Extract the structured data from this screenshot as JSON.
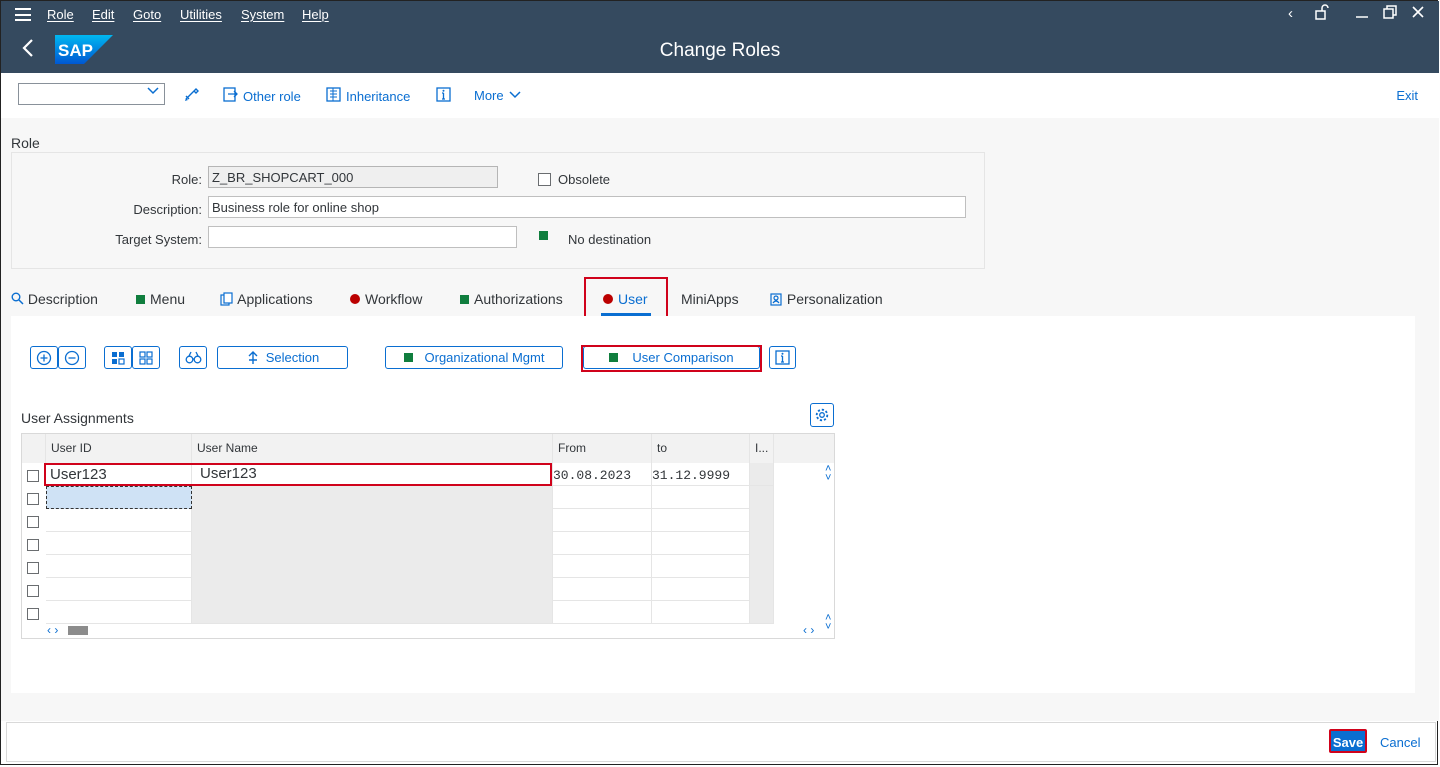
{
  "menubar": {
    "items": [
      "Role",
      "Edit",
      "Goto",
      "Utilities",
      "System",
      "Help"
    ]
  },
  "shell": {
    "title": "Change Roles",
    "logo": "SAP"
  },
  "toolbar": {
    "other_role": "Other role",
    "inheritance": "Inheritance",
    "more": "More",
    "exit": "Exit"
  },
  "role_section": {
    "heading": "Role",
    "role_label": "Role:",
    "role_value": "Z_BR_SHOPCART_000",
    "obsolete_label": "Obsolete",
    "description_label": "Description:",
    "description_value": "Business role for online shop",
    "target_system_label": "Target System:",
    "target_system_value": "",
    "destination_status": "No destination"
  },
  "tabs": [
    "Description",
    "Menu",
    "Applications",
    "Workflow",
    "Authorizations",
    "User",
    "MiniApps",
    "Personalization"
  ],
  "actions": {
    "selection": "Selection",
    "org_mgmt": "Organizational Mgmt",
    "user_comparison": "User Comparison"
  },
  "user_assignments": {
    "heading": "User Assignments",
    "columns": [
      "User ID",
      "User Name",
      "From",
      "to",
      "I..."
    ],
    "rows": [
      {
        "user_id": "User123",
        "user_name": "User123",
        "from": "30.08.2023",
        "to": "31.12.9999"
      }
    ]
  },
  "footer": {
    "save": "Save",
    "cancel": "Cancel"
  },
  "colors": {
    "shell": "#354a5f",
    "accent": "#0a6ed1",
    "status_green": "#107e3e",
    "status_red": "#bb0000",
    "highlight": "#d0021b"
  }
}
